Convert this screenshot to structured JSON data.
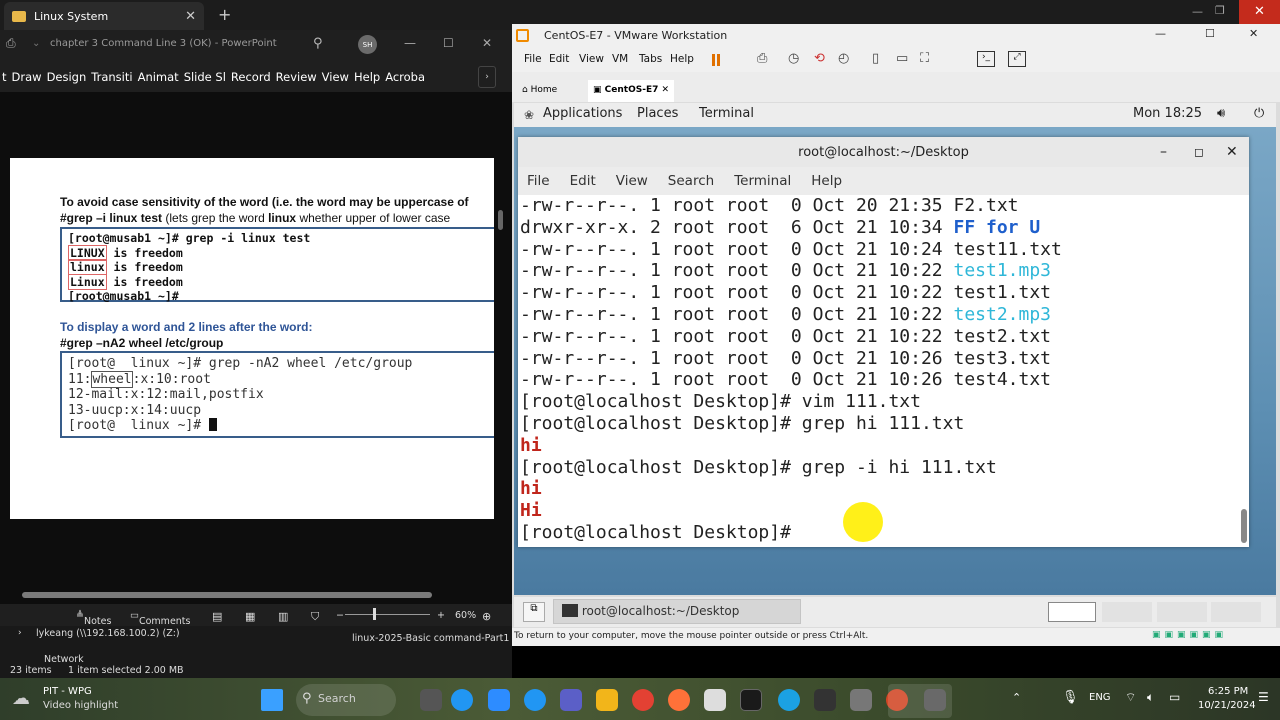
{
  "explorer": {
    "tab_title": "Linux System",
    "status_items": "23 items",
    "status_selected": "1 item selected  2.00 MB",
    "nav_items": [
      "lykeang (\\\\192.168.100.2) (Z:)",
      "Network"
    ]
  },
  "powerpoint": {
    "title": "chapter 3 Command Line 3 (OK)  -  PowerPoint",
    "avatar": "SH",
    "ribbon_tabs": [
      "t",
      "Draw",
      "Design",
      "Transiti",
      "Animat",
      "Slide Sl",
      "Record",
      "Review",
      "View",
      "Help",
      "Acroba"
    ],
    "status": {
      "notes": "Notes",
      "comments": "Comments",
      "zoom": "60%"
    },
    "slide": {
      "heading1": "To avoid case sensitivity of the word (i.e. the word may be uppercase of",
      "cmd1_prefix": "#grep –i linux  test",
      "cmd1_suffix": " (lets grep the word ",
      "cmd1_bold": "linux",
      "cmd1_tail": " whether upper of lower case",
      "box1": [
        "[root@musab1 ~]# grep -i linux test",
        "LINUX",
        "linux",
        "Linux",
        "[root@musab1 ~]#"
      ],
      "box1_suffix": " is freedom",
      "heading2": "To display a word and 2 lines after the word:",
      "cmd2": "#grep –nA2  wheel  /etc/group",
      "box2": [
        "[root@  linux ~]# grep -nA2 wheel /etc/group",
        "11:",
        "wheel",
        ":x:10:root",
        "12-mail:x:12:mail,postfix",
        "13-uucp:x:14:uucp",
        "[root@  linux ~]# "
      ]
    }
  },
  "taskbar_pp_file": "linux-2025-Basic command-Part1",
  "vmware": {
    "title": "CentOS-E7 - VMware Workstation",
    "menu": [
      "File",
      "Edit",
      "View",
      "VM",
      "Tabs",
      "Help"
    ],
    "tabs": [
      "Home",
      "CentOS-E7"
    ],
    "status_hint": "To return to your computer, move the mouse pointer outside or press Ctrl+Alt."
  },
  "gnome": {
    "applications": "Applications",
    "places": "Places",
    "terminal": "Terminal",
    "clock": "Mon 18:25",
    "taskbar_item": "root@localhost:~/Desktop"
  },
  "terminal": {
    "title": "root@localhost:~/Desktop",
    "menu": [
      "File",
      "Edit",
      "View",
      "Search",
      "Terminal",
      "Help"
    ],
    "listing": [
      {
        "perm": "-rw-r--r--. 1 root root  0 Oct 20 21:35 ",
        "name": "F2.txt",
        "kind": "plain"
      },
      {
        "perm": "drwxr-xr-x. 2 root root  6 Oct 21 10:34 ",
        "name": "FF for U",
        "kind": "dir"
      },
      {
        "perm": "-rw-r--r--. 1 root root  0 Oct 21 10:24 ",
        "name": "test11.txt",
        "kind": "plain"
      },
      {
        "perm": "-rw-r--r--. 1 root root  0 Oct 21 10:22 ",
        "name": "test1.mp3",
        "kind": "media"
      },
      {
        "perm": "-rw-r--r--. 1 root root  0 Oct 21 10:22 ",
        "name": "test1.txt",
        "kind": "plain"
      },
      {
        "perm": "-rw-r--r--. 1 root root  0 Oct 21 10:22 ",
        "name": "test2.mp3",
        "kind": "media"
      },
      {
        "perm": "-rw-r--r--. 1 root root  0 Oct 21 10:22 ",
        "name": "test2.txt",
        "kind": "plain"
      },
      {
        "perm": "-rw-r--r--. 1 root root  0 Oct 21 10:26 ",
        "name": "test3.txt",
        "kind": "plain"
      },
      {
        "perm": "-rw-r--r--. 1 root root  0 Oct 21 10:26 ",
        "name": "test4.txt",
        "kind": "plain"
      }
    ],
    "session": [
      {
        "text": "[root@localhost Desktop]# vim 111.txt",
        "kind": "prompt"
      },
      {
        "text": "[root@localhost Desktop]# grep hi 111.txt",
        "kind": "prompt"
      },
      {
        "text": "hi",
        "kind": "match"
      },
      {
        "text": "[root@localhost Desktop]# grep -i hi 111.txt",
        "kind": "prompt"
      },
      {
        "text": "hi",
        "kind": "match"
      },
      {
        "text": "Hi",
        "kind": "match"
      },
      {
        "text": "[root@localhost Desktop]# ",
        "kind": "prompt"
      }
    ]
  },
  "windows_taskbar": {
    "weather_title": "PIT - WPG",
    "weather_sub": "Video highlight",
    "search": "Search",
    "lang": "ENG",
    "time": "6:25 PM",
    "date": "10/21/2024"
  },
  "colors": {
    "terminal_match": "#c0261c",
    "terminal_media": "#2fb7d8",
    "terminal_dir": "#1e5fcc",
    "slide_heading": "#2f5597"
  }
}
